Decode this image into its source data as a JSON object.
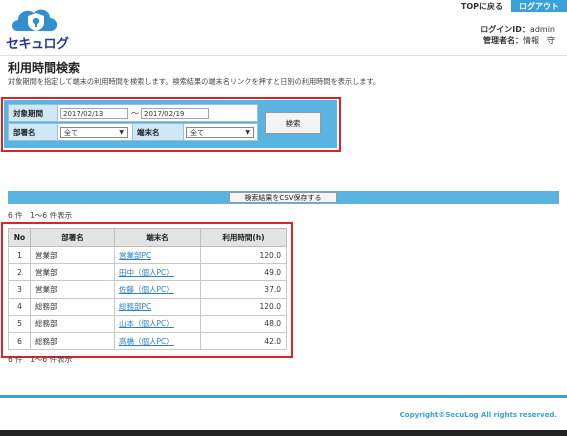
{
  "header": {
    "logo_text": "セキュログ",
    "top_link": "TOPに戻る",
    "logout": "ログアウト",
    "login_id_label": "ログインID：",
    "login_id": "admin",
    "admin_label": "管理者名：",
    "admin_name": "情報　守"
  },
  "page": {
    "title": "利用時間検索",
    "description": "対象期間を指定して端末の利用時間を検索します。検索結果の端末名リンクを押すと日別の利用時間を表示します。"
  },
  "form": {
    "period_label": "対象期間",
    "date_from": "2017/02/13",
    "tilde": "～",
    "date_to": "2017/02/19",
    "dept_label": "部署名",
    "dept_value": "全て",
    "terminal_label": "端末名",
    "terminal_value": "全て",
    "search_button": "検索"
  },
  "csv_button": "検索結果をCSV保存する",
  "count_text": "6 件　1～6 件表示",
  "table": {
    "headers": [
      "No",
      "部署名",
      "端末名",
      "利用時間(h)"
    ],
    "rows": [
      {
        "no": "1",
        "dept": "営業部",
        "terminal": "営業部PC",
        "hours": "120.0"
      },
      {
        "no": "2",
        "dept": "営業部",
        "terminal": "田中（個人PC）",
        "hours": "49.0"
      },
      {
        "no": "3",
        "dept": "営業部",
        "terminal": "佐藤（個人PC）",
        "hours": "37.0"
      },
      {
        "no": "4",
        "dept": "総務部",
        "terminal": "総務部PC",
        "hours": "120.0"
      },
      {
        "no": "5",
        "dept": "総務部",
        "terminal": "山本（個人PC）",
        "hours": "48.0"
      },
      {
        "no": "6",
        "dept": "総務部",
        "terminal": "高橋（個人PC）",
        "hours": "42.0"
      }
    ]
  },
  "footer": {
    "copyright": "Copyright©SecuLog All rights reserved."
  }
}
